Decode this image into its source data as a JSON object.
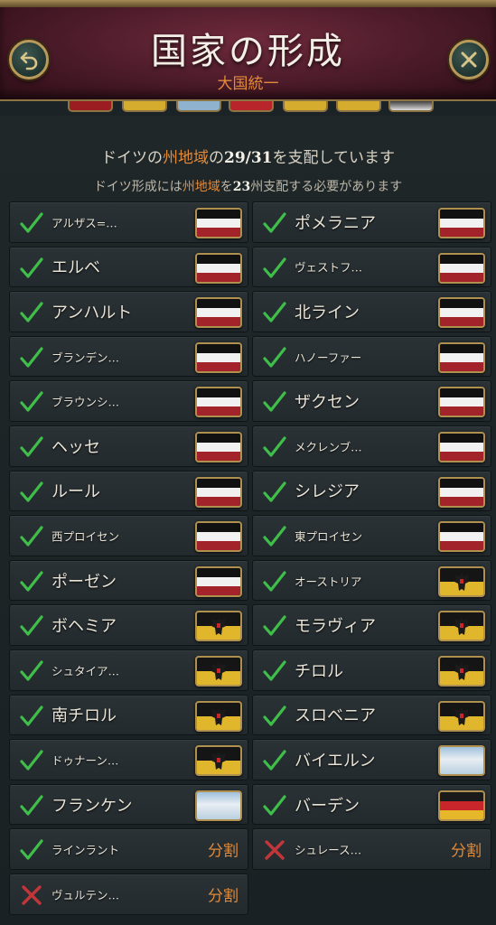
{
  "header": {
    "title": "国家の形成",
    "subtitle": "大国統一",
    "back_icon": "undo-arrow-icon",
    "close_icon": "close-icon"
  },
  "status": {
    "line1_prefix": "ドイツの",
    "line1_highlight": "州地域",
    "line1_mid": "の",
    "line1_count": "29/31",
    "line1_suffix": "を支配しています",
    "line2_prefix": "ドイツ形成には",
    "line2_highlight": "州地域",
    "line2_mid": "を",
    "line2_count": "23",
    "line2_suffix": "州支配する必要があります"
  },
  "colors": {
    "accent_orange": "#e08a3a",
    "check_green": "#3fbf4a",
    "cross_red": "#c2363a",
    "frame_gold": "#b0904f"
  },
  "states": [
    {
      "name": "アルザス=…",
      "status": "owned",
      "flag": "prussia"
    },
    {
      "name": "ポメラニア",
      "status": "owned",
      "flag": "prussia"
    },
    {
      "name": "エルベ",
      "status": "owned",
      "flag": "prussia"
    },
    {
      "name": "ヴェストフ…",
      "status": "owned",
      "flag": "prussia"
    },
    {
      "name": "アンハルト",
      "status": "owned",
      "flag": "prussia"
    },
    {
      "name": "北ライン",
      "status": "owned",
      "flag": "prussia"
    },
    {
      "name": "ブランデン…",
      "status": "owned",
      "flag": "prussia"
    },
    {
      "name": "ハノーファー",
      "status": "owned",
      "flag": "prussia"
    },
    {
      "name": "ブラウンシ…",
      "status": "owned",
      "flag": "prussia"
    },
    {
      "name": "ザクセン",
      "status": "owned",
      "flag": "prussia"
    },
    {
      "name": "ヘッセ",
      "status": "owned",
      "flag": "prussia"
    },
    {
      "name": "メクレンブ…",
      "status": "owned",
      "flag": "prussia"
    },
    {
      "name": "ルール",
      "status": "owned",
      "flag": "prussia"
    },
    {
      "name": "シレジア",
      "status": "owned",
      "flag": "prussia"
    },
    {
      "name": "西プロイセン",
      "status": "owned",
      "flag": "prussia"
    },
    {
      "name": "東プロイセン",
      "status": "owned",
      "flag": "prussia"
    },
    {
      "name": "ポーゼン",
      "status": "owned",
      "flag": "prussia"
    },
    {
      "name": "オーストリア",
      "status": "owned",
      "flag": "austria"
    },
    {
      "name": "ボヘミア",
      "status": "owned",
      "flag": "austria"
    },
    {
      "name": "モラヴィア",
      "status": "owned",
      "flag": "austria"
    },
    {
      "name": "シュタイア…",
      "status": "owned",
      "flag": "austria"
    },
    {
      "name": "チロル",
      "status": "owned",
      "flag": "austria"
    },
    {
      "name": "南チロル",
      "status": "owned",
      "flag": "austria"
    },
    {
      "name": "スロベニア",
      "status": "owned",
      "flag": "austria"
    },
    {
      "name": "ドゥナーン…",
      "status": "owned",
      "flag": "austria"
    },
    {
      "name": "バイエルン",
      "status": "owned",
      "flag": "bavaria"
    },
    {
      "name": "フランケン",
      "status": "owned",
      "flag": "bavaria"
    },
    {
      "name": "バーデン",
      "status": "owned",
      "flag": "baden"
    },
    {
      "name": "ラインラント",
      "status": "owned",
      "flag": "none",
      "extra": "分割"
    },
    {
      "name": "シュレース…",
      "status": "missing",
      "flag": "none",
      "extra": "分割"
    },
    {
      "name": "ヴュルテン…",
      "status": "missing",
      "flag": "none",
      "extra": "分割"
    }
  ]
}
